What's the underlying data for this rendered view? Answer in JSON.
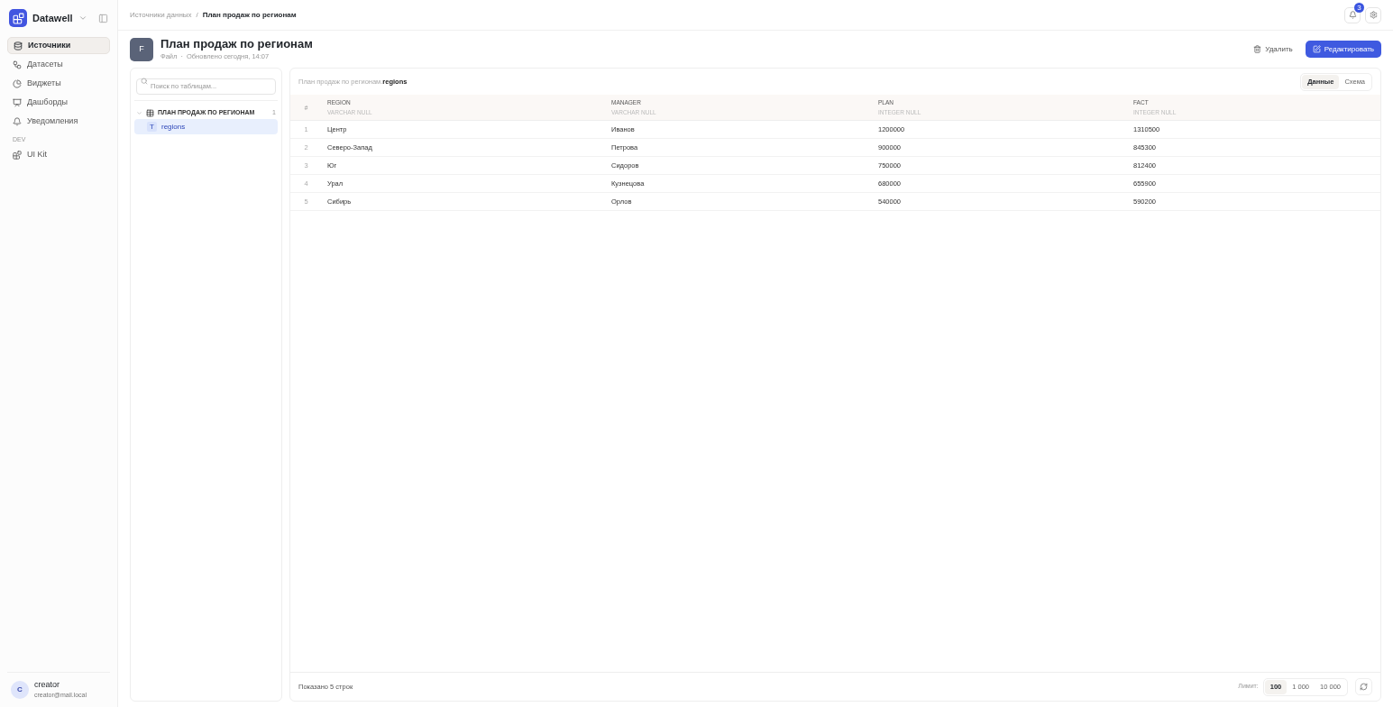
{
  "brand": {
    "name": "Datawell"
  },
  "sidebar": {
    "items": [
      {
        "label": "Источники",
        "selected": true
      },
      {
        "label": "Датасеты",
        "selected": false
      },
      {
        "label": "Виджеты",
        "selected": false
      },
      {
        "label": "Дашборды",
        "selected": false
      },
      {
        "label": "Уведомления",
        "selected": false
      }
    ],
    "section": "DEV",
    "dev_items": [
      {
        "label": "UI Kit",
        "selected": false
      }
    ],
    "user": {
      "initial": "C",
      "name": "creator",
      "email": "creator@mail.local"
    }
  },
  "breadcrumb": [
    "Источники данных",
    "План продаж по регионам"
  ],
  "breadcrumb_separator": "/",
  "notifications": {
    "count": "3"
  },
  "header": {
    "avatar": "F",
    "title": "План продаж по регионам",
    "type": "Файл",
    "separator": "·",
    "updated": "Обновлено сегодня, 14:07",
    "delete": "Удалить",
    "edit": "Редактировать"
  },
  "tree": {
    "search_placeholder": "Поиск по таблицам...",
    "group": {
      "label": "ПЛАН ПРОДАЖ ПО РЕГИОНАМ",
      "count": "1",
      "expanded": true,
      "children": [
        {
          "badge": "T",
          "label": "regions",
          "selected": true
        }
      ]
    }
  },
  "table": {
    "path_prefix": "План продаж по регионам.",
    "path_name": "regions",
    "views": [
      {
        "label": "Данные",
        "selected": true
      },
      {
        "label": "Схема",
        "selected": false
      }
    ],
    "columns": [
      {
        "name": "#"
      },
      {
        "name": "REGION",
        "type": "VARCHAR NULL"
      },
      {
        "name": "MANAGER",
        "type": "VARCHAR NULL"
      },
      {
        "name": "PLAN",
        "type": "INTEGER NULL"
      },
      {
        "name": "FACT",
        "type": "INTEGER NULL"
      }
    ],
    "rows": [
      [
        "1",
        "Центр",
        "Иванов",
        "1200000",
        "1310500"
      ],
      [
        "2",
        "Северо-Запад",
        "Петрова",
        "900000",
        "845300"
      ],
      [
        "3",
        "Юг",
        "Сидоров",
        "750000",
        "812400"
      ],
      [
        "4",
        "Урал",
        "Кузнецова",
        "680000",
        "655900"
      ],
      [
        "5",
        "Сибирь",
        "Орлов",
        "540000",
        "590200"
      ]
    ],
    "footer": "Показано 5 строк",
    "limit_label": "Лимит:",
    "limits": [
      {
        "label": "100",
        "selected": true
      },
      {
        "label": "1 000",
        "selected": false
      },
      {
        "label": "10 000",
        "selected": false
      }
    ]
  }
}
